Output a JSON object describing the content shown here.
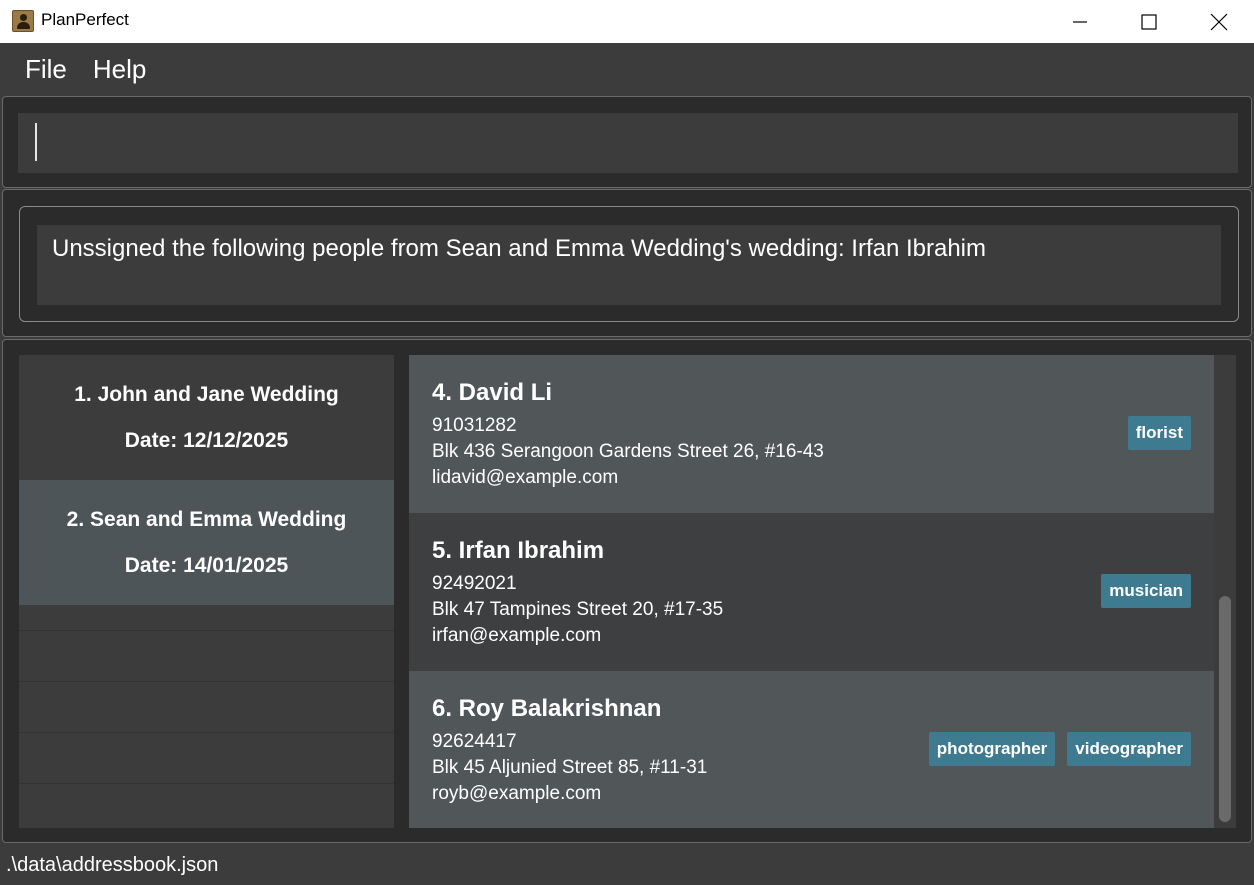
{
  "window": {
    "title": "PlanPerfect",
    "minimize_icon": "minimize-icon",
    "maximize_icon": "maximize-icon",
    "close_icon": "close-icon"
  },
  "menu": {
    "items": [
      {
        "label": "File"
      },
      {
        "label": "Help"
      }
    ]
  },
  "command_box": {
    "value": ""
  },
  "result_display": {
    "text": "Unssigned the following people from Sean and Emma Wedding's wedding: Irfan Ibrahim"
  },
  "weddings": [
    {
      "name": "1. John and Jane Wedding",
      "date": "Date: 12/12/2025",
      "selected": false
    },
    {
      "name": "2. Sean and Emma Wedding",
      "date": "Date: 14/01/2025",
      "selected": true
    }
  ],
  "persons": [
    {
      "name": "4. David Li",
      "phone": "91031282",
      "address": "Blk 436 Serangoon Gardens Street 26, #16-43",
      "email": "lidavid@example.com",
      "tags": [
        "florist"
      ]
    },
    {
      "name": "5. Irfan Ibrahim",
      "phone": "92492021",
      "address": "Blk 47 Tampines Street 20, #17-35",
      "email": "irfan@example.com",
      "tags": [
        "musician"
      ]
    },
    {
      "name": "6. Roy Balakrishnan",
      "phone": "92624417",
      "address": "Blk 45 Aljunied Street 85, #11-31",
      "email": "royb@example.com",
      "tags": [
        "photographer",
        "videographer"
      ]
    }
  ],
  "status_bar": {
    "file_path": ".\\data\\addressbook.json"
  },
  "colors": {
    "background": "#3c3c3c",
    "selected_card": "#4e5558",
    "tag": "#3e7b91"
  }
}
